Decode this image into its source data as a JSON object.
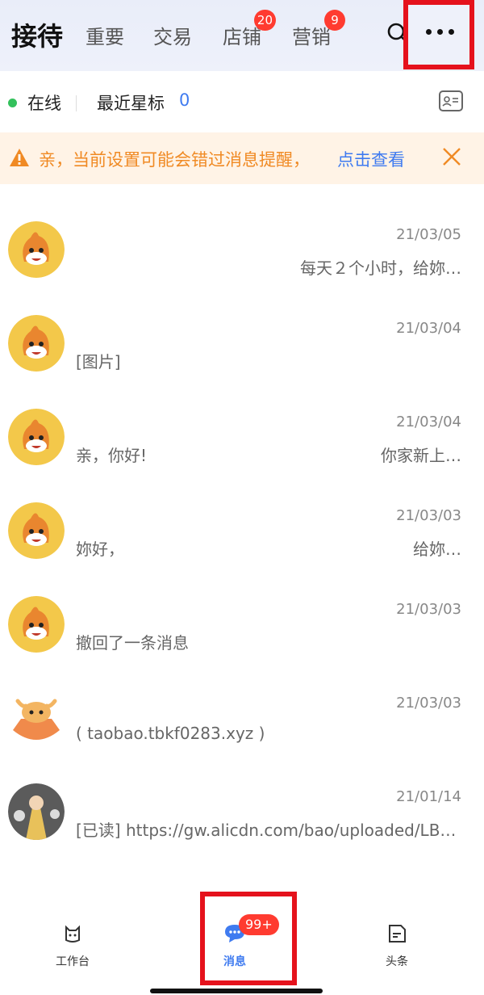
{
  "header": {
    "title": "接待",
    "tabs": [
      {
        "label": "重要",
        "badge": ""
      },
      {
        "label": "交易",
        "badge": ""
      },
      {
        "label": "店铺",
        "badge": "20"
      },
      {
        "label": "营销",
        "badge": "9"
      }
    ],
    "icons": {
      "search": "search-icon",
      "more": "more-dots-icon"
    }
  },
  "status": {
    "online_label": "在线",
    "star_label": "最近星标",
    "star_count": "0"
  },
  "warning": {
    "text": "亲，当前设置可能会错过消息提醒，",
    "link": "点击查看"
  },
  "conversations": [
    {
      "time": "21/03/05",
      "preview_left": "",
      "preview_right": "每天２个小时，给妳…"
    },
    {
      "time": "21/03/04",
      "preview_left": "[图片]",
      "preview_right": ""
    },
    {
      "time": "21/03/04",
      "preview_left": "亲，你好!",
      "preview_right": "你家新上…"
    },
    {
      "time": "21/03/03",
      "preview_left": "妳好，",
      "preview_right": "给妳…"
    },
    {
      "time": "21/03/03",
      "preview_left": "撤回了一条消息",
      "preview_right": ""
    },
    {
      "time": "21/03/03",
      "preview_left": "( taobao.tbkf0283.xyz )",
      "preview_right": ""
    },
    {
      "time": "21/01/14",
      "preview_left": "[已读] https://gw.alicdn.com/bao/uploaded/LB…",
      "preview_right": ""
    }
  ],
  "bottom_nav": {
    "items": [
      {
        "label": "工作台",
        "icon": "workbench-icon"
      },
      {
        "label": "消息",
        "icon": "message-icon"
      },
      {
        "label": "头条",
        "icon": "headlines-icon"
      }
    ],
    "message_badge": "99+"
  },
  "colors": {
    "accent_blue": "#3f7bf0",
    "badge_red": "#ff3b30",
    "highlight_red": "#e5121c",
    "warning_orange": "#f08a24",
    "online_green": "#33c15c"
  }
}
